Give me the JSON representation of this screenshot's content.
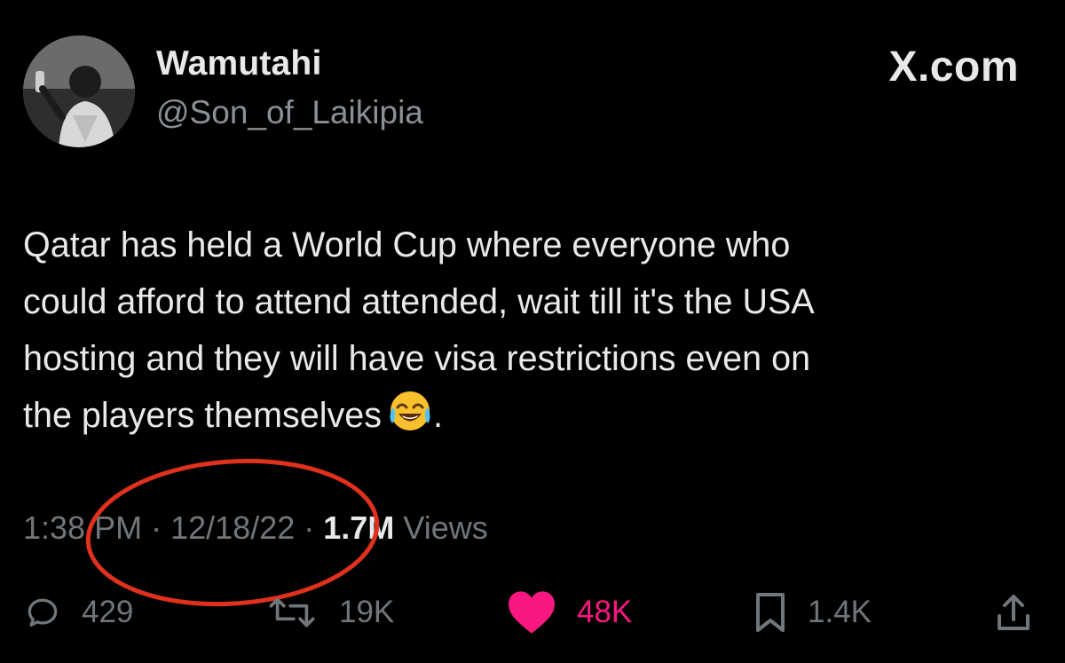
{
  "user": {
    "display_name": "Wamutahi",
    "handle": "@Son_of_Laikipia"
  },
  "brand": "X.com",
  "tweet": {
    "text": "Qatar has held a World Cup where everyone who\ncould afford to attend attended, wait till it's the USA\nhosting and they will have visa restrictions even  on\nthe players themselves",
    "emoji": "😂",
    "trailing": ".",
    "time": "1:38 PM",
    "separator": "·",
    "date": "12/18/22",
    "views_count": "1.7M",
    "views_label": "Views"
  },
  "actions": {
    "replies": "429",
    "reposts": "19K",
    "likes": "48K",
    "bookmarks": "1.4K"
  },
  "icons": {
    "reply": "reply-icon",
    "repost": "repost-icon",
    "like": "heart-icon",
    "bookmark": "bookmark-icon",
    "share": "share-icon"
  },
  "colors": {
    "background": "#000000",
    "text": "#e7e9ea",
    "secondary": "#71767b",
    "like": "#f91880",
    "annotation": "#e0301e"
  }
}
